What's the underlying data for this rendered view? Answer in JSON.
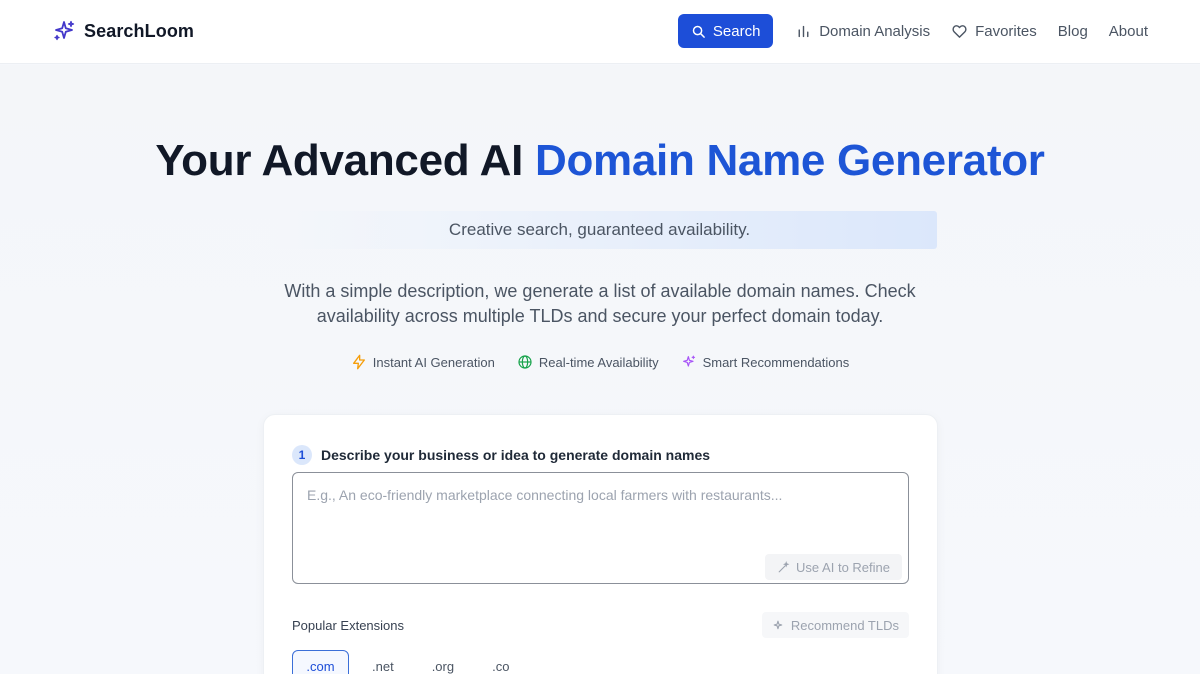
{
  "brand": {
    "name": "SearchLoom",
    "icon": "sparkle-icon"
  },
  "nav": {
    "search_label": "Search",
    "links": [
      {
        "label": "Domain Analysis",
        "icon": "bar-chart-icon"
      },
      {
        "label": "Favorites",
        "icon": "heart-icon"
      },
      {
        "label": "Blog"
      },
      {
        "label": "About"
      }
    ]
  },
  "hero": {
    "title_main": "Your Advanced AI",
    "title_accent": "Domain Name Generator",
    "tagline": "Creative search, guaranteed availability.",
    "description": "With a simple description, we generate a list of available domain names. Check availability across multiple TLDs and secure your perfect domain today.",
    "features": [
      {
        "label": "Instant AI Generation",
        "icon": "lightning-icon",
        "color": "#f59e0b"
      },
      {
        "label": "Real-time Availability",
        "icon": "globe-icon",
        "color": "#16a34a"
      },
      {
        "label": "Smart Recommendations",
        "icon": "sparkle-icon",
        "color": "#a855f7"
      }
    ]
  },
  "form": {
    "step_number": "1",
    "step_label": "Describe your business or idea to generate domain names",
    "placeholder": "E.g., An eco-friendly marketplace connecting local farmers with restaurants...",
    "refine_label": "Use AI to Refine",
    "extensions_label": "Popular Extensions",
    "recommend_label": "Recommend TLDs",
    "tlds": [
      ".com",
      ".net",
      ".org",
      ".co"
    ],
    "selected_tld": ".com"
  },
  "colors": {
    "primary": "#1d4ed8",
    "accent_text": "#1d55d6"
  }
}
